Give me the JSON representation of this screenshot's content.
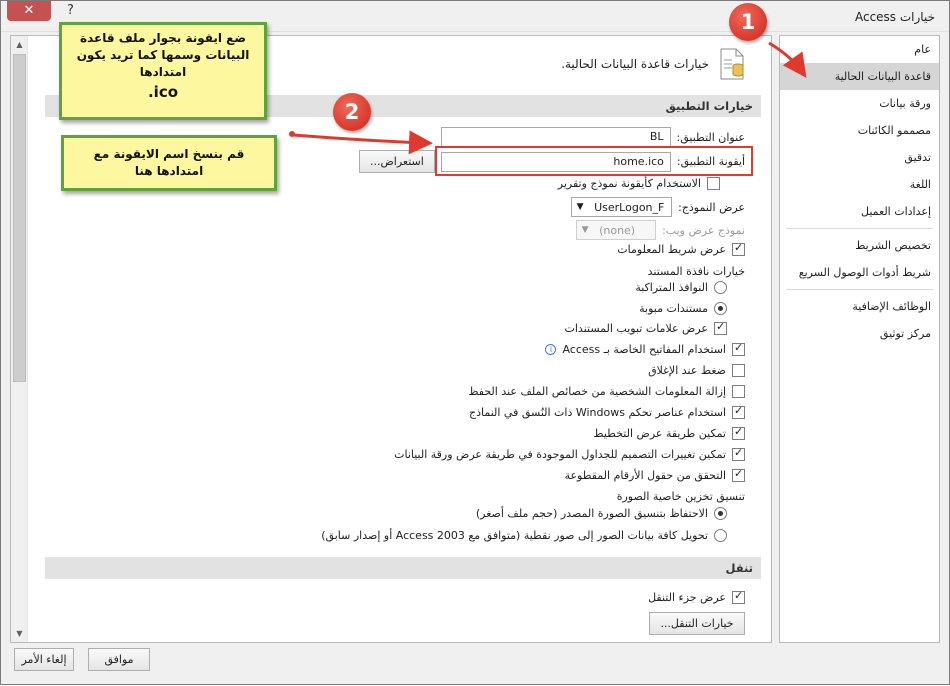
{
  "window": {
    "title": "خيارات Access",
    "close_label": "✕",
    "help_label": "?"
  },
  "nav": {
    "items": [
      {
        "label": "عام"
      },
      {
        "label": "قاعدة البيانات الحالية",
        "active": true
      },
      {
        "label": "ورقة بيانات"
      },
      {
        "label": "مصممو الكائنات"
      },
      {
        "label": "تدقيق"
      },
      {
        "label": "اللغة"
      },
      {
        "label": "إعدادات العميل"
      },
      {
        "label": "تخصيص الشريط"
      },
      {
        "label": "شريط أدوات الوصول السريع"
      },
      {
        "label": "الوظائف الإضافية"
      },
      {
        "label": "مركز توثيق"
      }
    ]
  },
  "main": {
    "header_text": "خيارات قاعدة البيانات الحالية.",
    "app_section_title": "خيارات التطبيق",
    "app_title_label": "عنوان التطبيق:",
    "app_title_value": "BL",
    "app_icon_label": "أيقونة التطبيق:",
    "app_icon_value": "home.ico",
    "browse_label": "استعراض...",
    "use_as_icon_label": "الاستخدام كأيقونة نموذج وتقرير",
    "display_form_label": "عرض النموذج:",
    "display_form_value": "UserLogon_F",
    "web_form_label": "نموذج عرض ويب:",
    "web_form_value": "(none)",
    "status_bar_label": "عرض شريط المعلومات",
    "doc_window_options_label": "خيارات نافذة المستند",
    "overlapping_label": "النوافذ المتراكبة",
    "tabbed_label": "مستندات مبوبة",
    "doc_tabs_label": "عرض علامات تبويب المستندات",
    "access_keys_label": "استخدام المفاتيح الخاصة بـ Access",
    "compact_close_label": "ضغط عند الإغلاق",
    "remove_personal_label": "إزالة المعلومات الشخصية من خصائص الملف عند الحفظ",
    "windows_themed_label": "استخدام عناصر تحكم Windows ذات النُسق في النماذج",
    "layout_view_label": "تمكين طريقة عرض التخطيط",
    "design_changes_label": "تمكين تغييرات التصميم للجداول الموجودة في طريقة عرض ورقة البيانات",
    "truncated_fields_label": "التحقق من حقول الأرقام المقطوعة",
    "picture_format_label": "تنسيق تخزين خاصية الصورة",
    "preserve_format_label": "الاحتفاظ بتنسيق الصورة المصدر (حجم ملف أصغر)",
    "convert_bitmap_label": "تحويل كافة بيانات الصور إلى صور نقطية (متوافق مع Access 2003 أو إصدار سابق)",
    "nav_section_title": "تنقل",
    "show_nav_pane_label": "عرض جزء التنقل",
    "nav_options_label": "خيارات التنقل..."
  },
  "buttons": {
    "ok_label": "موافق",
    "cancel_label": "إلغاء الأمر"
  },
  "annotations": {
    "callout1": "ضع ايقونة بجوار ملف قاعدة البيانات وسمها كما تريد يكون امتدادها",
    "callout1_ext": "ico.",
    "callout2": "قم بنسخ اسم الايقونة مع امتدادها هنا",
    "badge1": "1",
    "badge2": "2"
  },
  "colors": {
    "annotation_red": "#e03a2e",
    "callout_fill": "#fdf7a0",
    "callout_border": "#5fa33b",
    "nav_active": "#d5d5d5"
  }
}
